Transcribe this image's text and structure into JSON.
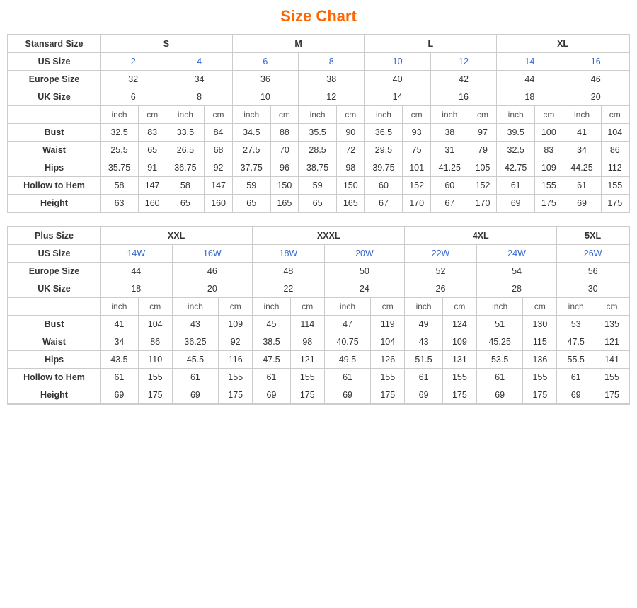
{
  "title": "Size Chart",
  "standard": {
    "section_label": "Stansard Size",
    "size_groups": [
      "S",
      "M",
      "L",
      "XL"
    ],
    "us_label": "US Size",
    "eu_label": "Europe Size",
    "uk_label": "UK Size",
    "us_sizes": [
      "2",
      "4",
      "6",
      "8",
      "10",
      "12",
      "14",
      "16"
    ],
    "eu_sizes": [
      "32",
      "34",
      "36",
      "38",
      "40",
      "42",
      "44",
      "46"
    ],
    "uk_sizes": [
      "6",
      "8",
      "10",
      "12",
      "14",
      "16",
      "18",
      "20"
    ],
    "measurements": {
      "bust_label": "Bust",
      "waist_label": "Waist",
      "hips_label": "Hips",
      "hollow_label": "Hollow to Hem",
      "height_label": "Height",
      "bust": [
        "32.5",
        "83",
        "33.5",
        "84",
        "34.5",
        "88",
        "35.5",
        "90",
        "36.5",
        "93",
        "38",
        "97",
        "39.5",
        "100",
        "41",
        "104"
      ],
      "waist": [
        "25.5",
        "65",
        "26.5",
        "68",
        "27.5",
        "70",
        "28.5",
        "72",
        "29.5",
        "75",
        "31",
        "79",
        "32.5",
        "83",
        "34",
        "86"
      ],
      "hips": [
        "35.75",
        "91",
        "36.75",
        "92",
        "37.75",
        "96",
        "38.75",
        "98",
        "39.75",
        "101",
        "41.25",
        "105",
        "42.75",
        "109",
        "44.25",
        "112"
      ],
      "hollow": [
        "58",
        "147",
        "58",
        "147",
        "59",
        "150",
        "59",
        "150",
        "60",
        "152",
        "60",
        "152",
        "61",
        "155",
        "61",
        "155"
      ],
      "height": [
        "63",
        "160",
        "65",
        "160",
        "65",
        "165",
        "65",
        "165",
        "67",
        "170",
        "67",
        "170",
        "69",
        "175",
        "69",
        "175"
      ]
    }
  },
  "plus": {
    "section_label": "Plus Size",
    "size_groups": [
      "XXL",
      "XXXL",
      "4XL",
      "5XL"
    ],
    "us_label": "US Size",
    "eu_label": "Europe Size",
    "uk_label": "UK Size",
    "us_sizes": [
      "14W",
      "16W",
      "18W",
      "20W",
      "22W",
      "24W",
      "26W"
    ],
    "eu_sizes": [
      "44",
      "46",
      "48",
      "50",
      "52",
      "54",
      "56"
    ],
    "uk_sizes": [
      "18",
      "20",
      "22",
      "24",
      "26",
      "28",
      "30"
    ],
    "measurements": {
      "bust_label": "Bust",
      "waist_label": "Waist",
      "hips_label": "Hips",
      "hollow_label": "Hollow to Hem",
      "height_label": "Height",
      "bust": [
        "41",
        "104",
        "43",
        "109",
        "45",
        "114",
        "47",
        "119",
        "49",
        "124",
        "51",
        "130",
        "53",
        "135"
      ],
      "waist": [
        "34",
        "86",
        "36.25",
        "92",
        "38.5",
        "98",
        "40.75",
        "104",
        "43",
        "109",
        "45.25",
        "115",
        "47.5",
        "121"
      ],
      "hips": [
        "43.5",
        "110",
        "45.5",
        "116",
        "47.5",
        "121",
        "49.5",
        "126",
        "51.5",
        "131",
        "53.5",
        "136",
        "55.5",
        "141"
      ],
      "hollow": [
        "61",
        "155",
        "61",
        "155",
        "61",
        "155",
        "61",
        "155",
        "61",
        "155",
        "61",
        "155",
        "61",
        "155"
      ],
      "height": [
        "69",
        "175",
        "69",
        "175",
        "69",
        "175",
        "69",
        "175",
        "69",
        "175",
        "69",
        "175",
        "69",
        "175"
      ]
    }
  }
}
